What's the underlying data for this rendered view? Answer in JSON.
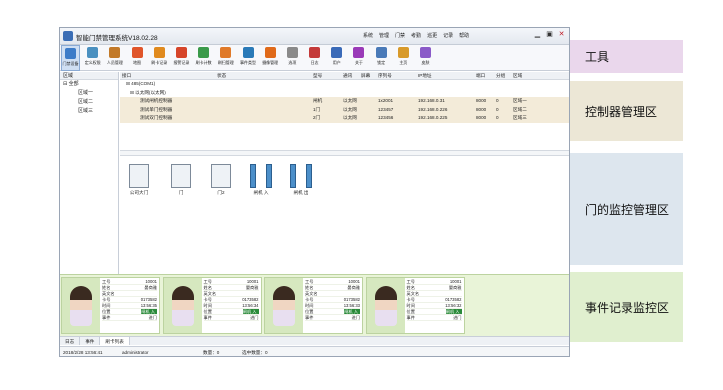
{
  "app": {
    "title": "智能门禁管理系统V18.02.28"
  },
  "menus": [
    "系统",
    "管理",
    "门禁",
    "考勤",
    "巡更",
    "记录",
    "帮助"
  ],
  "toolbar": {
    "items": [
      {
        "label": "门禁设备",
        "color": "#3d7cc8",
        "active": true
      },
      {
        "label": "定义权限",
        "color": "#4a90c0",
        "active": false
      },
      {
        "label": "人员管理",
        "color": "#c27a2a",
        "active": false
      },
      {
        "label": "地图",
        "color": "#e0552a",
        "active": false
      },
      {
        "label": "刷卡记录",
        "color": "#e08a1e",
        "active": false
      },
      {
        "label": "报警记录",
        "color": "#d6452a",
        "active": false
      },
      {
        "label": "刷卡计数",
        "color": "#3a9a4a",
        "active": false
      },
      {
        "label": "刷扫管理",
        "color": "#e07a2a",
        "active": false
      },
      {
        "label": "事件类型",
        "color": "#2a7ab8",
        "active": false
      },
      {
        "label": "摄像管理",
        "color": "#e06a1a",
        "active": false
      },
      {
        "label": "选项",
        "color": "#8a8a8a",
        "active": false
      },
      {
        "label": "日志",
        "color": "#c43a3a",
        "active": false
      },
      {
        "label": "用户",
        "color": "#3a6ab8",
        "active": false
      },
      {
        "label": "关于",
        "color": "#9a3ab8",
        "active": false
      },
      {
        "label": "锁定",
        "color": "#4a7ab8",
        "active": false
      },
      {
        "label": "主页",
        "color": "#d89a2a",
        "active": false
      },
      {
        "label": "皮肤",
        "color": "#8a5ac8",
        "active": false
      }
    ]
  },
  "sidebar": {
    "header": "区域",
    "root": "全部",
    "items": [
      "区域一",
      "区域二",
      "区域三"
    ]
  },
  "grid": {
    "headers": [
      "接口",
      "状态",
      "型号",
      "通讯",
      "屏幕",
      "序列号",
      "IP地址",
      "端口",
      "分组",
      "区域"
    ],
    "group1": "485(COM1)",
    "group2": "以太网(以太网)",
    "rows": [
      [
        "测试闸机控制器",
        "",
        "闸机",
        "以太网",
        "",
        "1x2001",
        "192.168.0.31",
        "8000",
        "0",
        "区域一"
      ],
      [
        "测试单门控制器",
        "",
        "1门",
        "以太网",
        "",
        "123457",
        "192.168.0.226",
        "8000",
        "0",
        "区域二"
      ],
      [
        "测试双门控制器",
        "",
        "2门",
        "以太网",
        "",
        "123456",
        "192.168.0.225",
        "8000",
        "0",
        "区域三"
      ]
    ]
  },
  "doors": [
    {
      "label": "公司大门",
      "kind": "door"
    },
    {
      "label": "门",
      "kind": "door"
    },
    {
      "label": "门2",
      "kind": "door"
    },
    {
      "label": "闸机 入",
      "kind": "turnstile"
    },
    {
      "label": "闸机 出",
      "kind": "turnstile"
    }
  ],
  "records": [
    {
      "no": "10001",
      "name": "晏商雅",
      "en": "",
      "card": "0173582",
      "time": "13:56:35",
      "pos": "闸机 入",
      "event": "进门"
    },
    {
      "no": "10001",
      "name": "晏商雅",
      "en": "",
      "card": "0173582",
      "time": "13:56:34",
      "pos": "闸机 入",
      "event": "进门"
    },
    {
      "no": "10001",
      "name": "晏商雅",
      "en": "",
      "card": "0173582",
      "time": "13:56:33",
      "pos": "闸机 入",
      "event": "进门"
    },
    {
      "no": "10001",
      "name": "晏商雅",
      "en": "",
      "card": "0173582",
      "time": "13:56:32",
      "pos": "闸机 入",
      "event": "进门"
    }
  ],
  "record_labels": {
    "no": "工号",
    "name": "姓名",
    "en": "英文名",
    "card": "卡号",
    "time": "时间",
    "pos": "位置",
    "event": "事件"
  },
  "tabs": [
    "日志",
    "事件",
    "刷卡列表"
  ],
  "status": {
    "datetime": "2018/2/28 13:56:41",
    "user": "administrator",
    "count_label": "数量：0",
    "selected_label": "选中数量：0"
  },
  "callouts": [
    {
      "text": "工具",
      "color": "#ead7ec"
    },
    {
      "text": "控制器管理区",
      "color": "#ece7d6"
    },
    {
      "text": "门的监控管理区",
      "color": "#dde6ee"
    },
    {
      "text": "事件记录监控区",
      "color": "#e0efcf"
    }
  ]
}
